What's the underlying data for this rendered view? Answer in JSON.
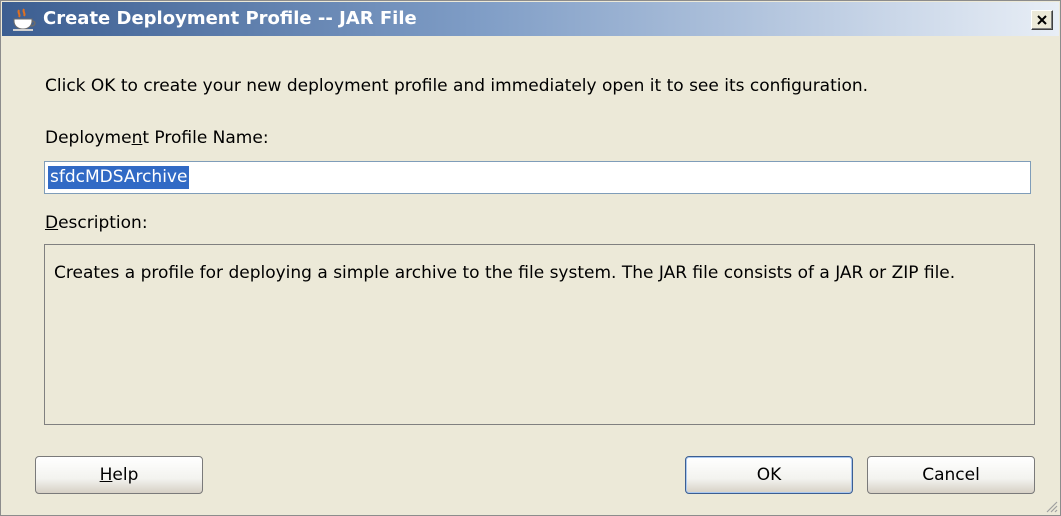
{
  "window": {
    "title": "Create Deployment Profile -- JAR File",
    "icon": "coffee-cup-icon",
    "close_icon": "close-icon"
  },
  "instruction": "Click OK to create your new deployment profile and immediately open it to see its configuration.",
  "name_field": {
    "label_before": "Deploy",
    "label_pre_mnemonic": "me",
    "label_mnemonic": "n",
    "label_after": "t Profile Name:",
    "value": "sfdcMDSArchive"
  },
  "description": {
    "label_mnemonic": "D",
    "label_rest": "escription:",
    "text": "Creates a profile for deploying a simple archive to the file system. The JAR file consists of a JAR or ZIP file."
  },
  "buttons": {
    "help_mnemonic": "H",
    "help_rest": "elp",
    "ok": "OK",
    "cancel": "Cancel"
  },
  "colors": {
    "title_bar": "#3c5e91",
    "selection": "#316ac5",
    "dialog_bg": "#ece9d8"
  }
}
